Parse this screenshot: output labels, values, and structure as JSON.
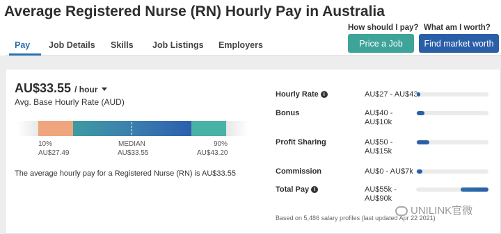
{
  "header": {
    "title": "Average Registered Nurse (RN) Hourly Pay in Australia",
    "question_price": "How should I pay?",
    "question_worth": "What am I worth?",
    "price_job_label": "Price a Job",
    "market_worth_label": "Find market worth"
  },
  "tabs": [
    {
      "label": "Pay"
    },
    {
      "label": "Job Details"
    },
    {
      "label": "Skills"
    },
    {
      "label": "Job Listings"
    },
    {
      "label": "Employers"
    }
  ],
  "pay": {
    "rate": "AU$33.55",
    "rate_unit": "/ hour",
    "subtitle": "Avg. Base Hourly Rate (AUD)",
    "distribution": {
      "p10_label": "10%",
      "p10_value": "AU$27.49",
      "median_label": "MEDIAN",
      "median_value": "AU$33.55",
      "p90_label": "90%",
      "p90_value": "AU$43.20"
    },
    "summary": "The average hourly pay for a Registered Nurse (RN) is AU$33.55"
  },
  "breakdown": [
    {
      "label": "Hourly Rate",
      "range_line1": "AU$27 - AU$43",
      "range_line2": "",
      "info": true
    },
    {
      "label": "Bonus",
      "range_line1": "AU$40 -",
      "range_line2": "AU$10k",
      "info": false
    },
    {
      "label": "Profit Sharing",
      "range_line1": "AU$50 -",
      "range_line2": "AU$15k",
      "info": false
    },
    {
      "label": "Commission",
      "range_line1": "AU$0 - AU$7k",
      "range_line2": "",
      "info": false
    },
    {
      "label": "Total Pay",
      "range_line1": "AU$55k -",
      "range_line2": "AU$90k",
      "info": true
    }
  ],
  "footnote": "Based on 5,486 salary profiles (last updated Apr 22 2021)",
  "watermark": "UNILINK官微",
  "colors": {
    "accent_blue": "#2a5fa8",
    "accent_teal": "#3ea49a",
    "tab_active": "#2a6fb0",
    "dist_orange": "#efa57d",
    "dist_green": "#49b2a6"
  }
}
